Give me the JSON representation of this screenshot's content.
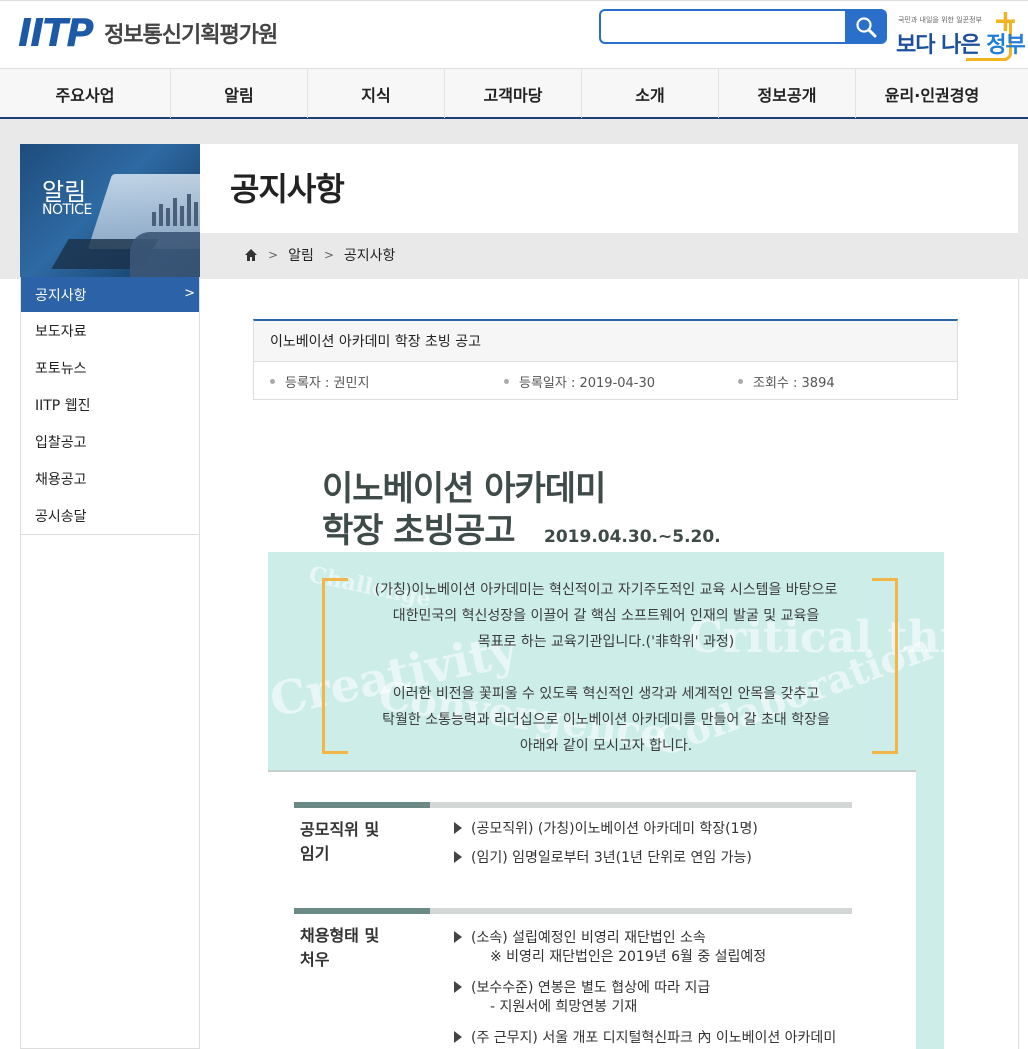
{
  "header": {
    "logo_mark": "IITP",
    "logo_text": "정보통신기획평가원",
    "search_placeholder": "",
    "gov_small": "국민과 내일을 위한 일꾼정부",
    "gov_big_a": "보다 나은",
    "gov_big_b": "정부"
  },
  "gnb": {
    "items": [
      "주요사업",
      "알림",
      "지식",
      "고객마당",
      "소개",
      "정보공개",
      "윤리·인권경영"
    ]
  },
  "lnb": {
    "title": "알림",
    "subtitle": "NOTICE",
    "items": [
      "공지사항",
      "보도자료",
      "포토뉴스",
      "IITP 웹진",
      "입찰공고",
      "채용공고",
      "공시송달"
    ]
  },
  "page": {
    "title": "공지사항",
    "breadcrumb": [
      "알림",
      "공지사항"
    ]
  },
  "board": {
    "title": "이노베이션 아카데미 학장 초빙 공고",
    "author": "등록자 : 권민지",
    "date": "등록일자 : 2019-04-30",
    "views": "조회수 : 3894"
  },
  "poster": {
    "title_line1": "이노베이션 아카데미",
    "title_line2": "학장 초빙공고",
    "period": "2019.04.30.~5.20.",
    "watermarks": [
      "Challenge",
      "Creativity",
      "Convergence",
      "Collaboration",
      "Critical thinking"
    ],
    "intro_1": "(가칭)이노베이션 아카데미는 혁신적이고 자기주도적인 교육 시스템을 바탕으로",
    "intro_2": "대한민국의 혁신성장을 이끌어 갈 핵심 소프트웨어 인재의 발굴 및 교육을",
    "intro_3": "목표로 하는 교육기관입니다.('非학위' 과정)",
    "intro_4": "이러한 비전을 꽃피울 수 있도록 혁신적인 생각과 세계적인 안목을 갖추고",
    "intro_5": "탁월한 소통능력과 리더십으로 이노베이션 아카데미를 만들어 갈 초대 학장을",
    "intro_6": "아래와 같이 모시고자 합니다.",
    "sec1_label_1": "공모직위 및",
    "sec1_label_2": "임기",
    "sec1_line1": "(공모직위) (가칭)이노베이션 아카데미 학장(1명)",
    "sec1_line2": "(임기) 임명일로부터 3년(1년 단위로 연임 가능)",
    "sec2_label_1": "채용형태 및",
    "sec2_label_2": "처우",
    "sec2_line1": "(소속) 설립예정인 비영리 재단법인 소속",
    "sec2_note1": "※ 비영리 재단법인은 2019년 6월 중 설립예정",
    "sec2_line2": "(보수수준) 연봉은 별도 협상에 따라 지급",
    "sec2_note2": "- 지원서에 희망연봉 기재",
    "sec2_line3": "(주 근무지) 서울 개포 디지털혁신파크 內 이노베이션 아카데미"
  },
  "colors": {
    "brand_blue": "#2b62a8",
    "nav_border": "#1d3f73",
    "poster_teal": "#cdeee8",
    "bracket_orange": "#f2b54a"
  }
}
